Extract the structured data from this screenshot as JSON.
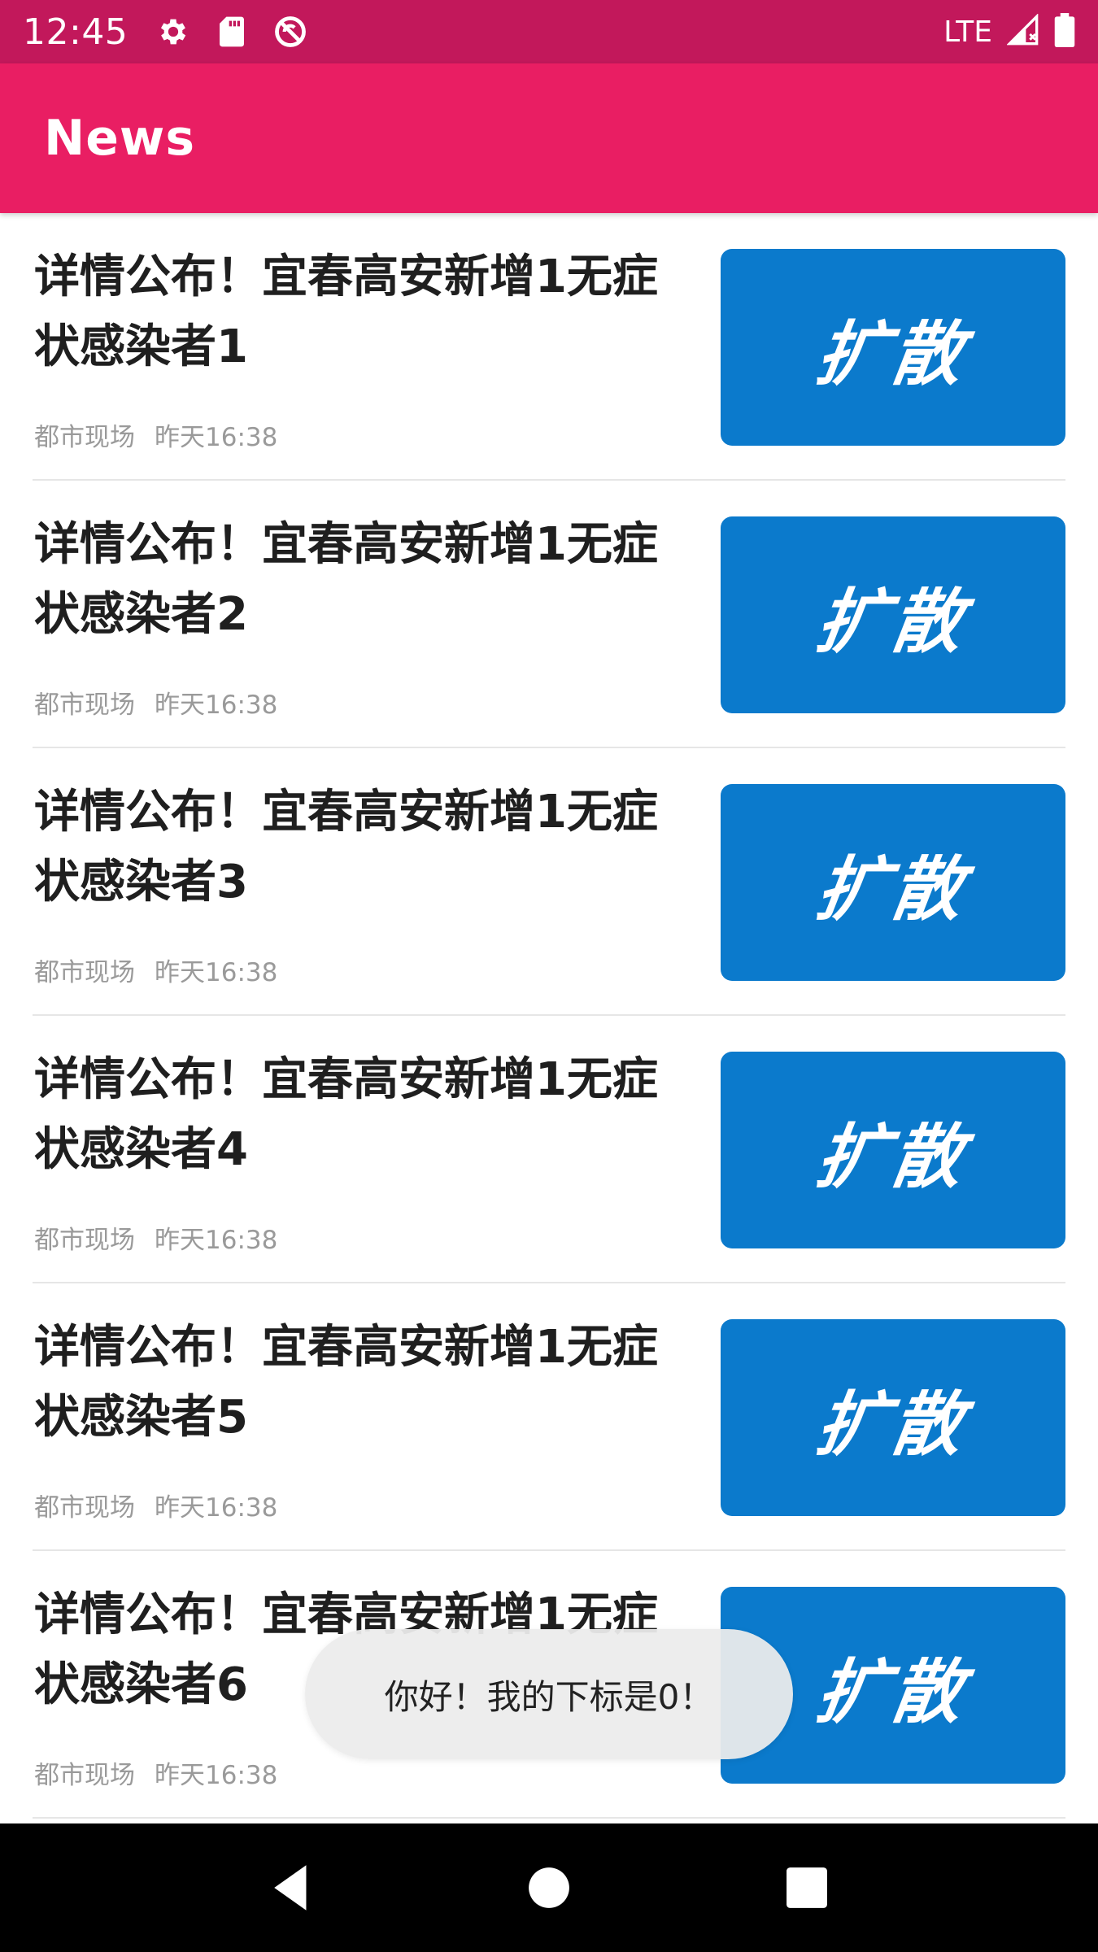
{
  "status_bar": {
    "time": "12:45",
    "network": "LTE",
    "icons": [
      "gear-icon",
      "sd-card-icon",
      "no-sync-icon",
      "signal-icon",
      "battery-icon"
    ]
  },
  "app_bar": {
    "title": "News"
  },
  "news": [
    {
      "title": "详情公布！宜春高安新增1无症状感染者1",
      "source": "都市现场",
      "time": "昨天16:38",
      "thumb_text": "扩散"
    },
    {
      "title": "详情公布！宜春高安新增1无症状感染者2",
      "source": "都市现场",
      "time": "昨天16:38",
      "thumb_text": "扩散"
    },
    {
      "title": "详情公布！宜春高安新增1无症状感染者3",
      "source": "都市现场",
      "time": "昨天16:38",
      "thumb_text": "扩散"
    },
    {
      "title": "详情公布！宜春高安新增1无症状感染者4",
      "source": "都市现场",
      "time": "昨天16:38",
      "thumb_text": "扩散"
    },
    {
      "title": "详情公布！宜春高安新增1无症状感染者5",
      "source": "都市现场",
      "time": "昨天16:38",
      "thumb_text": "扩散"
    },
    {
      "title": "详情公布！宜春高安新增1无症状感染者6",
      "source": "都市现场",
      "time": "昨天16:38",
      "thumb_text": "扩散"
    }
  ],
  "toast": {
    "text": "你好！我的下标是0！"
  },
  "colors": {
    "status_bar": "#c2185b",
    "app_bar": "#e91e63",
    "thumb": "#0b7acc",
    "meta_text": "#9a9a9a"
  },
  "nav_bar": {
    "icons": [
      "back-icon",
      "home-icon",
      "recents-icon"
    ]
  }
}
